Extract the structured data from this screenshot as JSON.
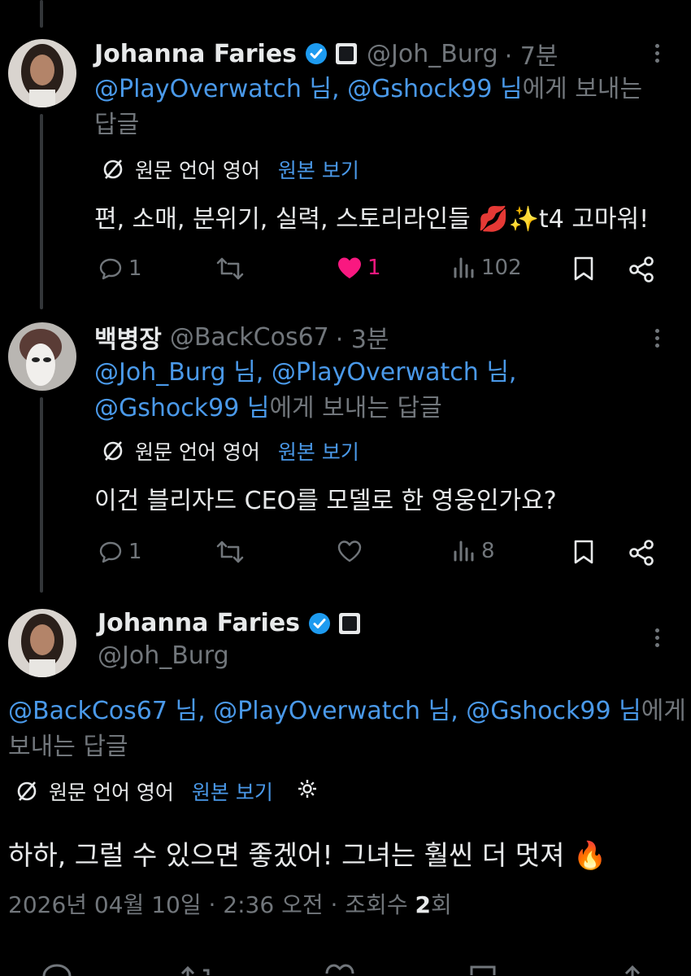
{
  "tweets": [
    {
      "name": "Johanna Faries",
      "handle": "@Joh_Burg",
      "time": "· 7분",
      "reply_line1_m1": "@PlayOverwatch 님,",
      "reply_line1_m2": " @Gshock99 님",
      "reply_line1_rest": "에게 보내는",
      "reply_line2": "답글",
      "translate_label": "원문 언어 영어",
      "translate_link": "원본 보기",
      "text": "편, 소매, 분위기, 실력, 스토리라인들 💋✨t4 고마워!",
      "replies": "1",
      "retweets": "",
      "likes": "1",
      "liked": true,
      "views": "102"
    },
    {
      "name": "백병장",
      "handle": "@BackCos67",
      "time": "· 3분",
      "reply_line1": "@Joh_Burg 님, @PlayOverwatch 님,",
      "reply_line2_m": "@Gshock99 님",
      "reply_line2_rest": "에게 보내는 답글",
      "translate_label": "원문 언어 영어",
      "translate_link": "원본 보기",
      "text": "이건 블리자드 CEO를 모델로 한 영웅인가요?",
      "replies": "1",
      "retweets": "",
      "likes": "",
      "liked": false,
      "views": "8"
    }
  ],
  "main_tweet": {
    "name": "Johanna Faries",
    "handle": "@Joh_Burg",
    "reply_line1_m": "@BackCos67 님, @PlayOverwatch 님, @Gshock99 님",
    "reply_line1_rest": "에게",
    "reply_line2": "보내는 답글",
    "translate_label": "원문 언어 영어",
    "translate_link": "원본 보기",
    "text": "하하, 그럴 수 있으면 좋겠어! 그녀는 훨씬 더 멋져 🔥",
    "timestamp": "2026년 04월 10일 · 2:36 오전 · 조회수 ",
    "views_count": "2",
    "views_suffix": "회"
  },
  "icons": [
    "verified-badge-icon",
    "affiliate-badge-icon",
    "more-icon",
    "translate-icon",
    "reply-icon",
    "retweet-icon",
    "like-icon",
    "views-icon",
    "bookmark-icon",
    "share-icon",
    "settings-icon"
  ],
  "colors": {
    "background": "#000000",
    "text": "#e7e9ea",
    "muted": "#71767b",
    "link": "#4a99e9",
    "like": "#f91880",
    "verified": "#1d9bf0"
  }
}
